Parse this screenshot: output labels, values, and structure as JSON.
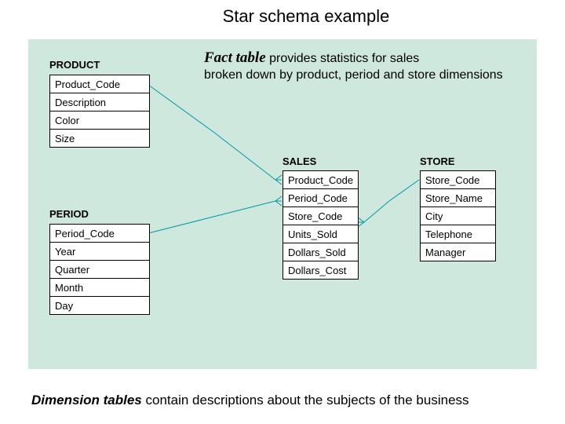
{
  "title": "Star schema example",
  "callout": {
    "bold": "Fact table",
    "rest1": " provides statistics for sales",
    "rest2": "broken down by product, period and store dimensions"
  },
  "footer": {
    "bold": "Dimension tables",
    "rest": " contain descriptions about the subjects of the business"
  },
  "tables": {
    "product": {
      "name": "PRODUCT",
      "fields": [
        "Product_Code",
        "Description",
        "Color",
        "Size"
      ]
    },
    "period": {
      "name": "PERIOD",
      "fields": [
        "Period_Code",
        "Year",
        "Quarter",
        "Month",
        "Day"
      ]
    },
    "sales": {
      "name": "SALES",
      "fields": [
        "Product_Code",
        "Period_Code",
        "Store_Code",
        "Units_Sold",
        "Dollars_Sold",
        "Dollars_Cost"
      ]
    },
    "store": {
      "name": "STORE",
      "fields": [
        "Store_Code",
        "Store_Name",
        "City",
        "Telephone",
        "Manager"
      ]
    }
  }
}
